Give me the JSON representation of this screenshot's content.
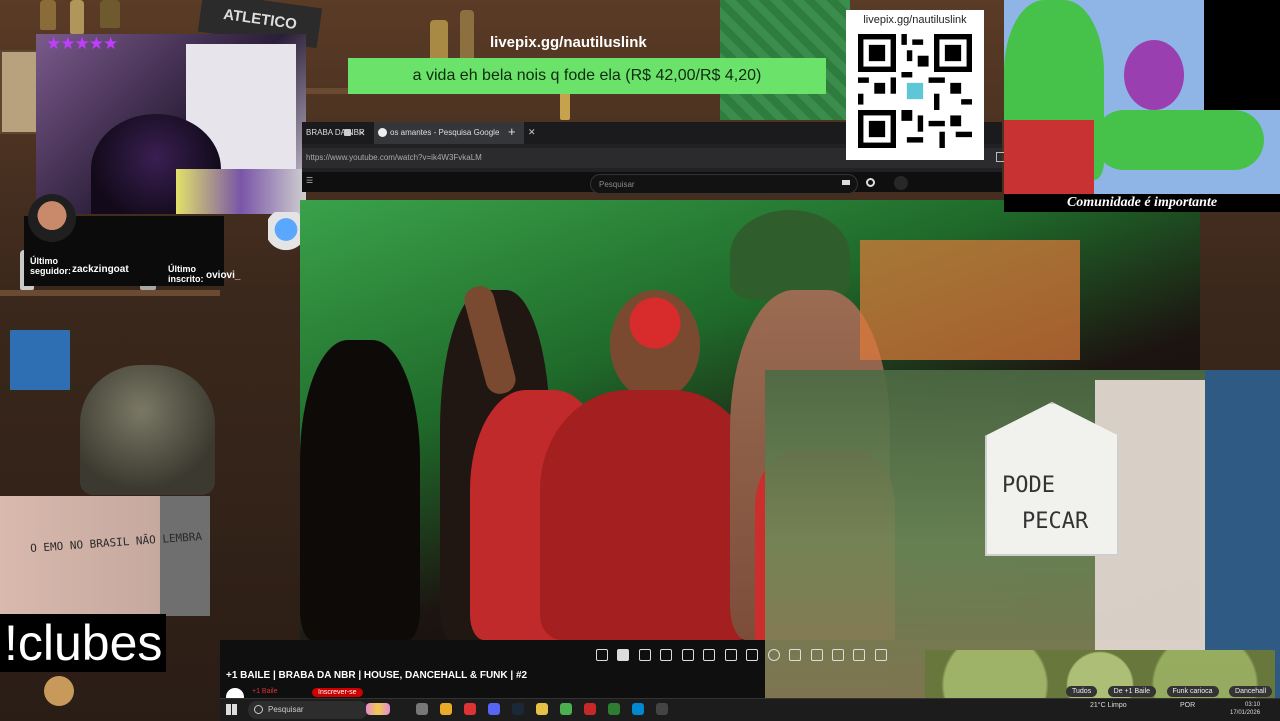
{
  "overlay": {
    "pix_url": "livepix.gg/nautiluslink",
    "donation_message": "a vida eh bela nois q fode ela (R$ 42,00/R$ 4,20)",
    "qr_url": "livepix.gg/nautiluslink",
    "stars": "★★★★★",
    "clubes_command": "!clubes",
    "community_caption": "Comunidade é importante",
    "stadium_sign": "ATLETICO"
  },
  "followers": {
    "last_follower_label": "Último seguidor:",
    "last_follower_name": "zackzingoat",
    "last_sub_label": "Último inscrito:",
    "last_sub_name": "oviovi_"
  },
  "browser": {
    "tabs": [
      {
        "label": "BRABA DA NBR"
      },
      {
        "label": "os amantes - Pesquisa Google"
      }
    ],
    "new_tab": "+",
    "url": "https://www.youtube.com/watch?v=ik4W3FvkaLM",
    "search_placeholder": "Pesquisar"
  },
  "video": {
    "title": "+1 BAILE | BRABA DA NBR | HOUSE, DANCEHALL & FUNK | #2",
    "channel": "+1 Baile",
    "subscribe": "Inscrever-se",
    "sign_line1": "PODE",
    "sign_line2": "PECAR",
    "graffiti": "O EMO NO BRASIL NÃO LEMBRA"
  },
  "recommendation_chips": [
    "Tudos",
    "De +1 Baile",
    "Funk carioca",
    "Dancehall"
  ],
  "taskbar": {
    "search_placeholder": "Pesquisar",
    "weather": "21°C Limpo",
    "language": "POR",
    "time": "03:10",
    "date": "17/01/2026"
  },
  "colors": {
    "donation_bg": "#6be36b",
    "stars": "#c03cff",
    "taskbar_bg": "#1c1c1c"
  }
}
